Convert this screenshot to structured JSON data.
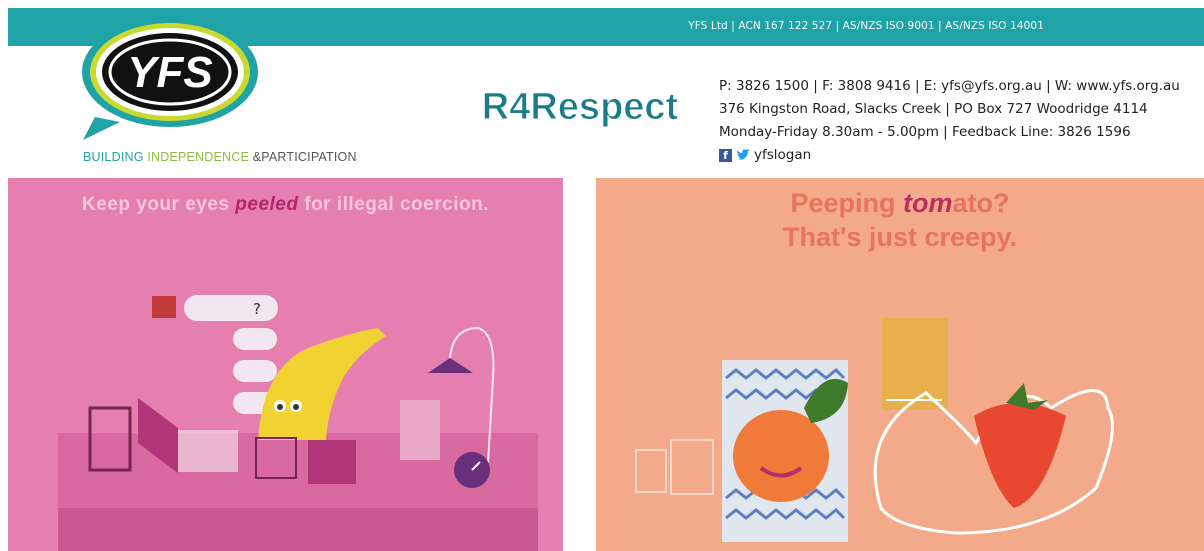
{
  "header": {
    "company_line": "YFS Ltd  |  ACN 167 122 527  |  AS/NZS ISO 9001  |  AS/NZS ISO 14001",
    "logo_text": "YFS",
    "tagline": {
      "part1": "BUILDING ",
      "part2": "INDEPENDENCE ",
      "part3": "&",
      "part4": "PARTICIPATION"
    },
    "campaign_logo": "R4Respect",
    "contact": {
      "line1": "P: 3826 1500 | F: 3808 9416 | E: yfs@yfs.org.au | W: www.yfs.org.au",
      "line2": "376 Kingston Road, Slacks Creek | PO Box 727 Woodridge 4114",
      "line3": "Monday-Friday 8.30am - 5.00pm | Feedback Line: 3826 1596",
      "social_handle": "yfslogan"
    }
  },
  "panel_left": {
    "headline_before": "Keep your eyes ",
    "headline_em": "peeled",
    "headline_after": " for illegal coercion.",
    "chat_question": "?"
  },
  "panel_right": {
    "headline_line1_before": "Peeping ",
    "headline_line1_em": "tom",
    "headline_line1_after": "ato?",
    "headline_line2": "That's just creepy."
  },
  "colors": {
    "teal": "#1fa3a6",
    "green": "#8cbd3f",
    "pink_panel": "#e47faf",
    "peach_panel": "#f3aa8a"
  }
}
